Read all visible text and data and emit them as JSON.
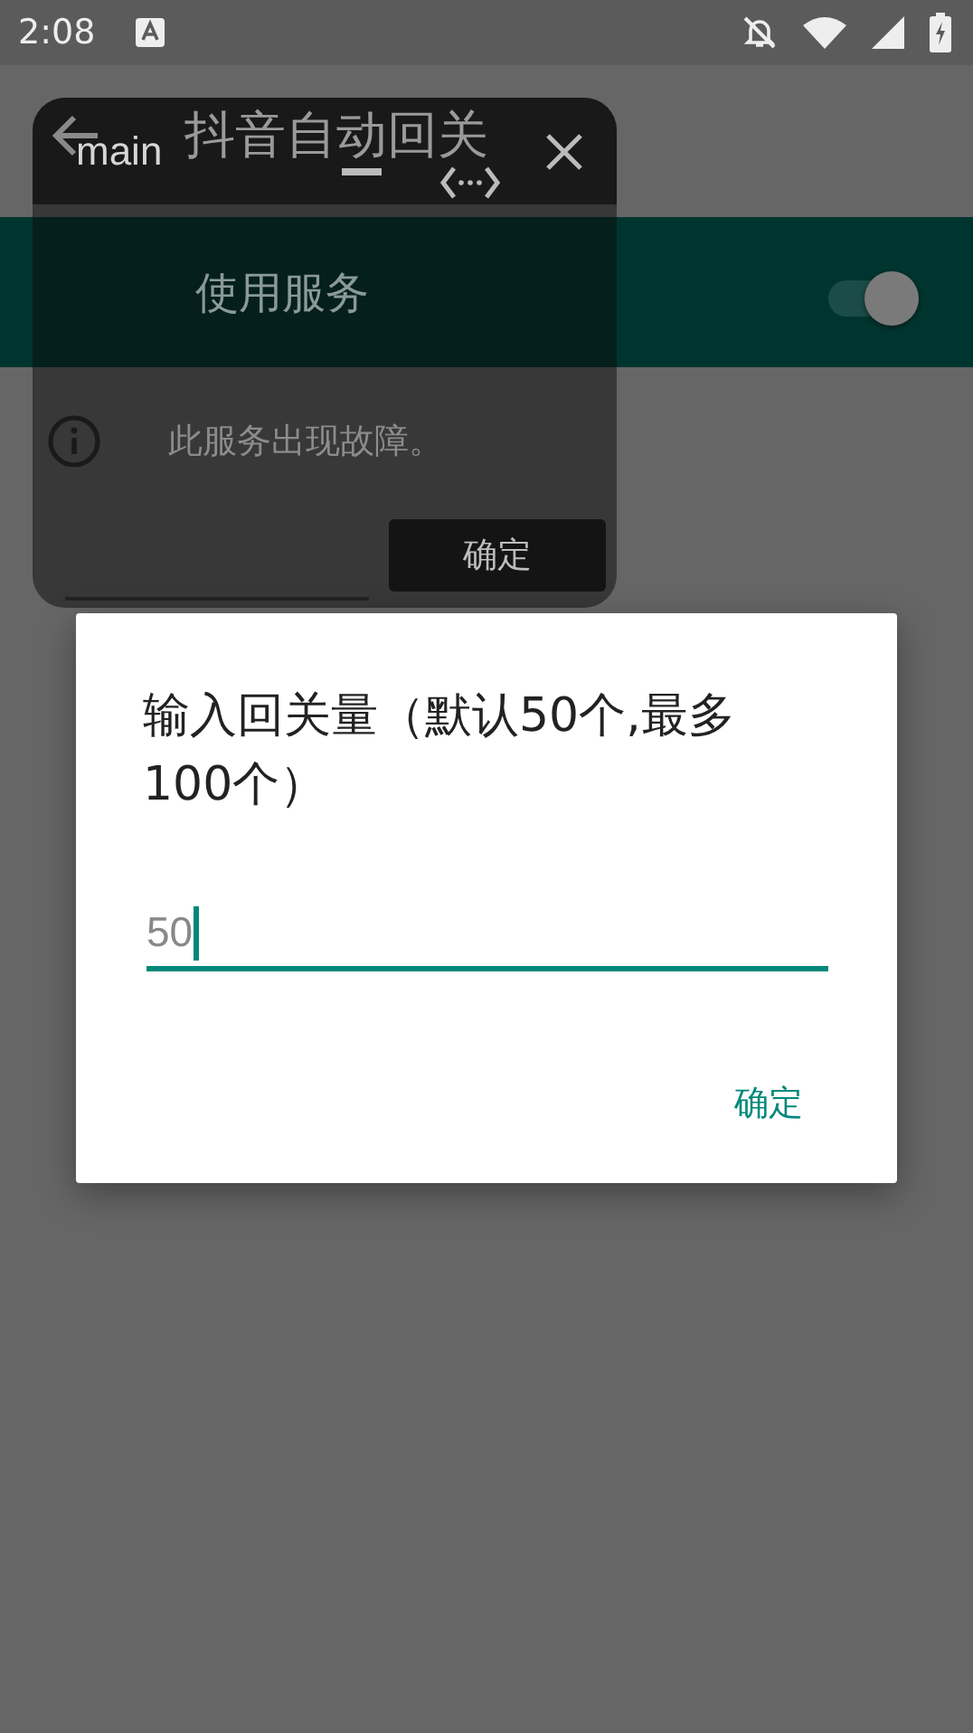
{
  "status_bar": {
    "time": "2:08"
  },
  "app_bar": {
    "title": "抖音自动回关"
  },
  "service_switch": {
    "label": "使用服务",
    "on": true
  },
  "notice": {
    "text": "此服务出现故障。"
  },
  "floating_window": {
    "title": "main",
    "button": "确定"
  },
  "dialog": {
    "title": "输入回关量（默认50个,最多100个）",
    "field": {
      "placeholder": "50"
    },
    "button": "确定"
  }
}
